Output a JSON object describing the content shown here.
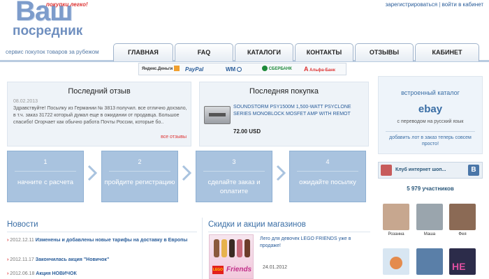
{
  "logo": {
    "big": "Ваш",
    "small": "посредник",
    "tag": "покупки легко!"
  },
  "top_links": {
    "register": "зарегистрироваться",
    "separator": "|",
    "login": "войти в кабинет"
  },
  "slogan": "сервис покупок товаров за рубежом",
  "nav": {
    "tabs": [
      "ГЛАВНАЯ",
      "FAQ",
      "КАТАЛОГИ",
      "КОНТАКТЫ",
      "ОТЗЫВЫ",
      "КАБИНЕТ"
    ]
  },
  "payments": [
    {
      "label": "Яндекс.Деньги",
      "color": "#333333"
    },
    {
      "label": "PayPal",
      "color": "#2a5d9a"
    },
    {
      "label": "WM",
      "color": "#2a5d9a"
    },
    {
      "label": "СБЕРБАНК",
      "color": "#1e8a3a"
    },
    {
      "label": "Альфа-Банк",
      "color": "#d33333"
    }
  ],
  "last_review": {
    "title": "Последний отзыв",
    "date": "08.02.2013",
    "text": "Здравствуйте! Посылку из Германии № 3813 получил. все отлично дохэало, в т.ч. заказ 31722 который думал еще в ожидании от продавца. Большое спасибо! Огорчает как обычно работа Почты России, которые бо..",
    "link": "все отзывы"
  },
  "last_purchase": {
    "title": "Последняя покупка",
    "product": "SOUNDSTORM PSY1500M 1,500-WATT PSYCLONE SERIES MONOBLOCK MOSFET AMP WITH REMOT",
    "price": "72.00 USD"
  },
  "catalog": {
    "title": "встроенный каталог",
    "brand": "ebay",
    "subtitle": "с переводом на русский язык",
    "note": "добавить лот в заказ теперь совсем просто!"
  },
  "steps": [
    {
      "num": "1",
      "text": "начните с расчета"
    },
    {
      "num": "2",
      "text": "пройдите регистрацию"
    },
    {
      "num": "3",
      "text": "сделайте заказ и оплатите"
    },
    {
      "num": "4",
      "text": "ожидайте посылку"
    }
  ],
  "vk": {
    "club": "Клуб интернет шоп...",
    "logo": "В",
    "members": "5 979 участников",
    "avatars": [
      {
        "name": "Розанна",
        "color": "#c7a78f"
      },
      {
        "name": "Маша",
        "color": "#9aa5ad"
      },
      {
        "name": "Фея",
        "color": "#8b6a55"
      },
      {
        "name": "",
        "color": "#d8e6f2"
      },
      {
        "name": "",
        "color": "#5a7fa8"
      },
      {
        "name": "",
        "color": "#2c2c4a"
      }
    ]
  },
  "news": {
    "title": "Новости",
    "items": [
      {
        "date": "2012.12.11",
        "text": "Изменены и добавлены новые тарифы на доставку в Европы"
      },
      {
        "date": "2012.11.17",
        "text": "Закончилась акция \"Новичок\""
      },
      {
        "date": "2012.06.18",
        "text": "Акция НОВИЧОК"
      }
    ]
  },
  "promos": {
    "title": "Скидки и акции магазинов",
    "item_text": "Лего для девочек LEGO FRIENDS уже в продаже!",
    "item_date": "24.01.2012",
    "lego": "LEGO",
    "friends": "Friends"
  }
}
